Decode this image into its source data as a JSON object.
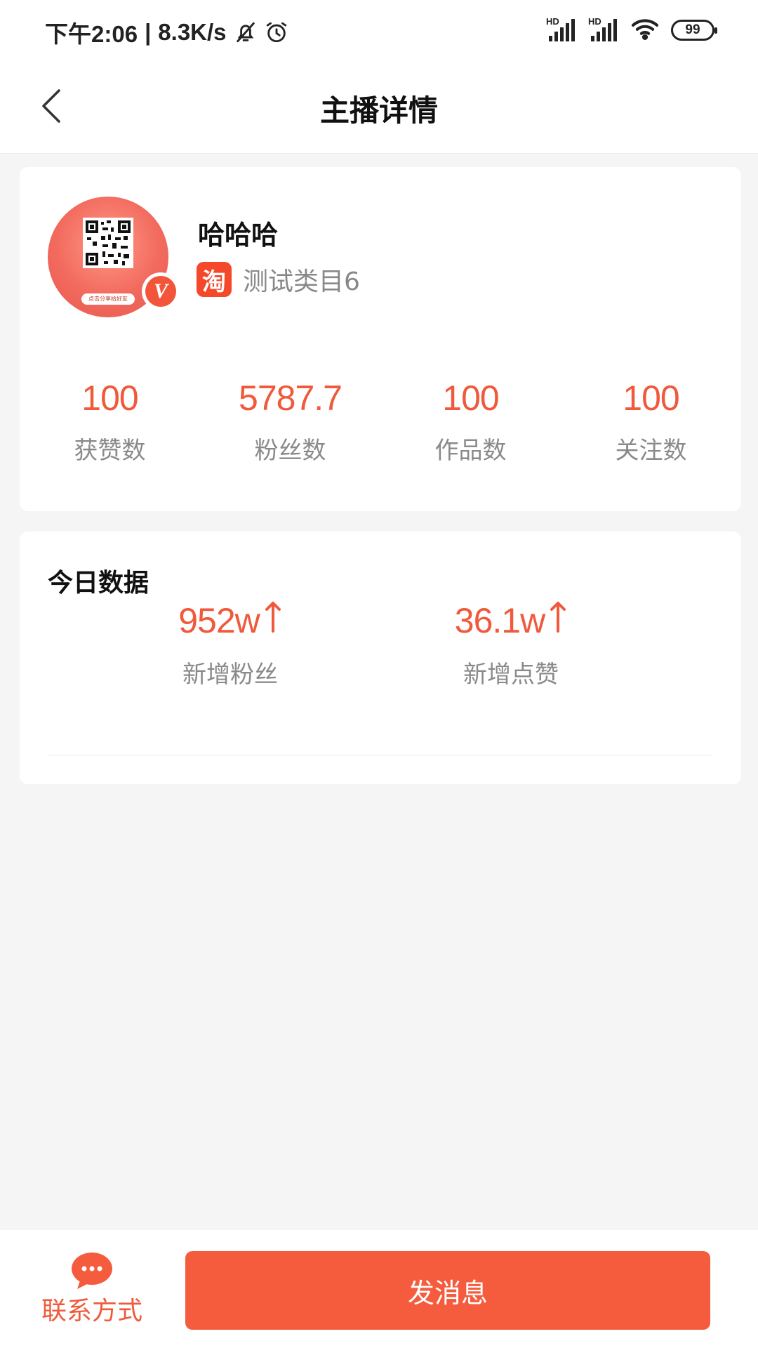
{
  "status_bar": {
    "time": "下午2:06",
    "net_speed": "8.3K/s",
    "sim1_label": "HD",
    "sim2_label": "HD",
    "battery": "99"
  },
  "header": {
    "title": "主播详情"
  },
  "profile": {
    "name": "哈哈哈",
    "platform_icon_text": "淘",
    "category": "测试类目6",
    "avatar_caption": "点击分享给好友",
    "verified_mark": "V"
  },
  "stats": [
    {
      "value": "100",
      "label": "获赞数"
    },
    {
      "value": "5787.7",
      "label": "粉丝数"
    },
    {
      "value": "100",
      "label": "作品数"
    },
    {
      "value": "100",
      "label": "关注数"
    }
  ],
  "today": {
    "title": "今日数据",
    "items": [
      {
        "value": "952w",
        "label": "新增粉丝"
      },
      {
        "value": "36.1w",
        "label": "新增点赞"
      }
    ]
  },
  "bottom": {
    "contact_label": "联系方式",
    "send_label": "发消息"
  },
  "colors": {
    "accent": "#f0593b",
    "button": "#f45c3d",
    "background": "#f5f5f5"
  },
  "icons": {
    "back": "chevron-left-icon",
    "bell_off": "bell-off-icon",
    "alarm": "alarm-clock-icon",
    "wifi": "wifi-icon",
    "arrow_up": "arrow-up-icon",
    "chat": "chat-bubble-icon"
  }
}
